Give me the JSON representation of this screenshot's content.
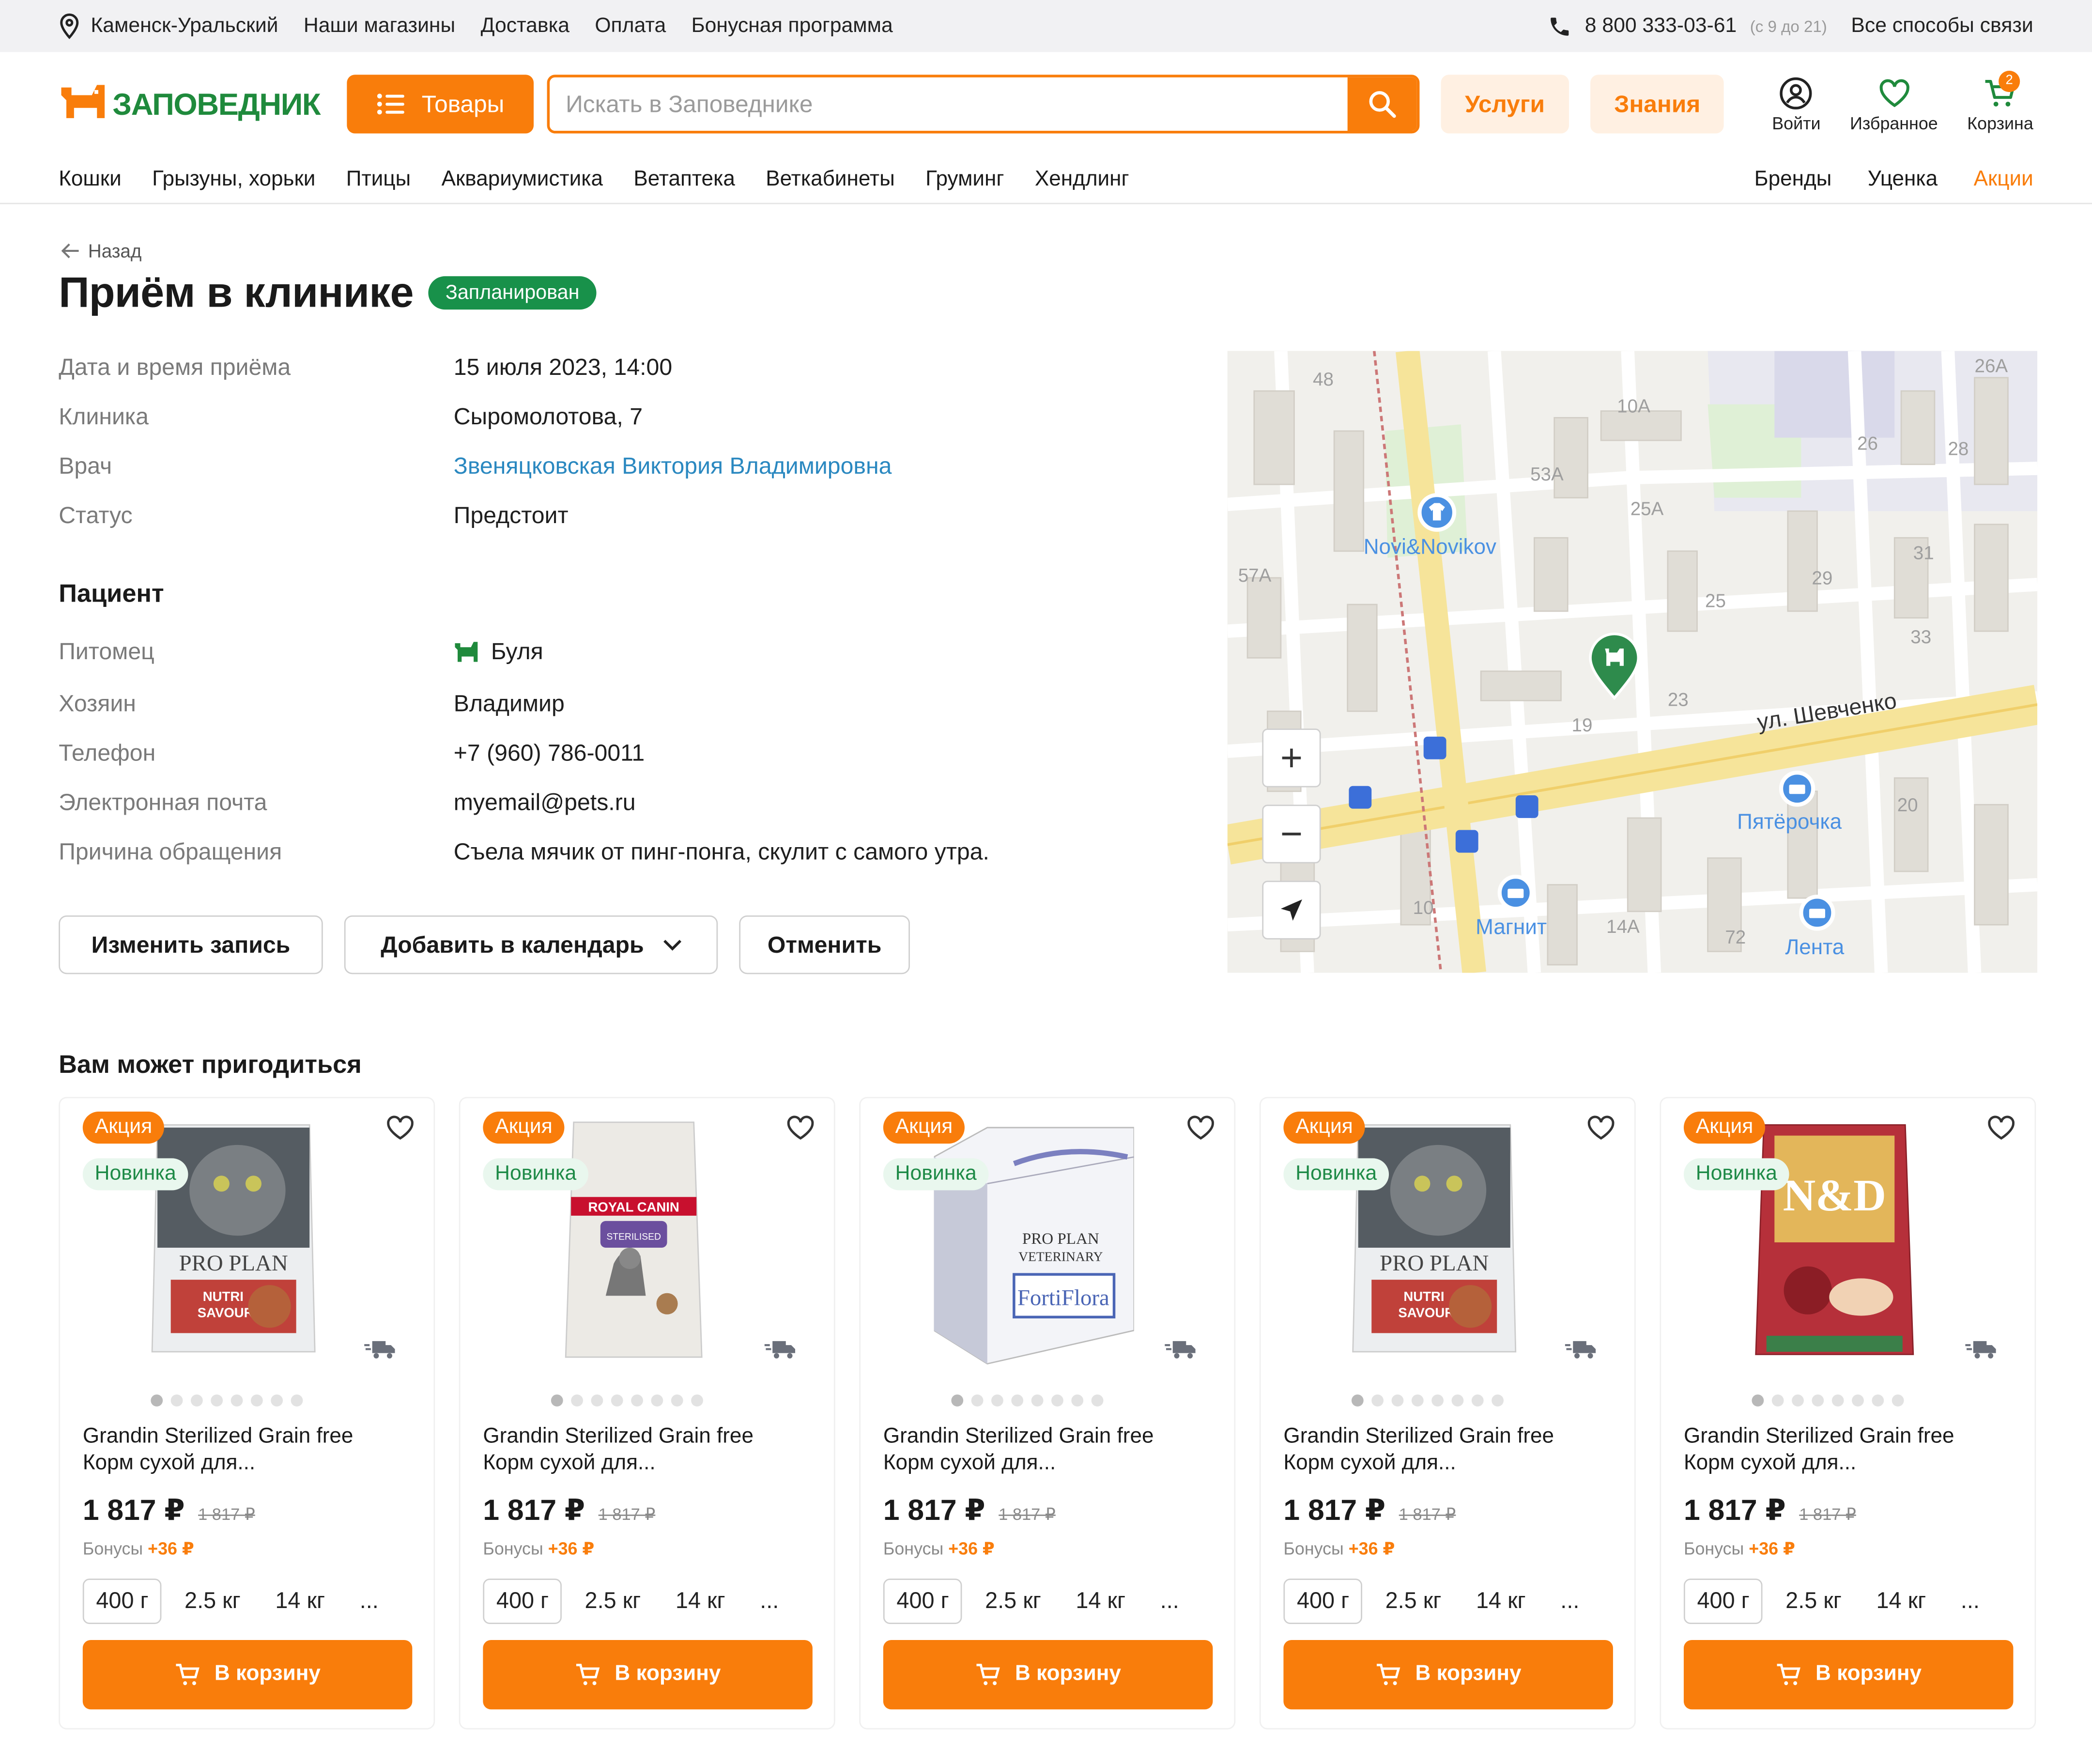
{
  "topbar": {
    "city": "Каменск-Уральский",
    "links": [
      "Наши магазины",
      "Доставка",
      "Оплата",
      "Бонусная программа"
    ],
    "phone": "8 800 333-03-61",
    "hours": "(с 9 до 21)",
    "contacts": "Все способы связи"
  },
  "header": {
    "logo_text": "ЗАПОВЕДНИК",
    "goods_button": "Товары",
    "search_placeholder": "Искать в Заповеднике",
    "services": "Услуги",
    "knowledge": "Знания",
    "login": "Войти",
    "favorites": "Избранное",
    "cart": "Корзина",
    "cart_count": "2"
  },
  "nav": {
    "left": [
      "Кошки",
      "Грызуны, хорьки",
      "Птицы",
      "Аквариумистика",
      "Ветаптека",
      "Веткабинеты",
      "Груминг",
      "Хендлинг"
    ],
    "right": [
      "Бренды",
      "Уценка",
      "Акции"
    ]
  },
  "page": {
    "back": "Назад",
    "title": "Приём в клинике",
    "status_badge": "Запланирован",
    "details": [
      {
        "label": "Дата и время приёма",
        "value": "15 июля 2023,  14:00"
      },
      {
        "label": "Клиника",
        "value": "Сыромолотова, 7"
      },
      {
        "label": "Врач",
        "value": "Звеняцковская Виктория Владимировна"
      },
      {
        "label": "Статус",
        "value": "Предстоит"
      }
    ],
    "patient_heading": "Пациент",
    "patient": [
      {
        "label": "Питомец",
        "value": "Буля"
      },
      {
        "label": "Хозяин",
        "value": "Владимир"
      },
      {
        "label": "Телефон",
        "value": "+7 (960) 786-0011"
      },
      {
        "label": "Электронная почта",
        "value": "myemail@pets.ru"
      },
      {
        "label": "Причина обращения",
        "value": "Съела мячик от пинг-понга, скулит с самого утра."
      }
    ],
    "buttons": {
      "edit": "Изменить запись",
      "calendar": "Добавить в календарь",
      "cancel": "Отменить"
    }
  },
  "map": {
    "street": "ул. Шевченко",
    "pois": [
      "Novi&Novikov",
      "Пятёрочка",
      "Магнит",
      "Лента"
    ],
    "houses": [
      "48",
      "10A",
      "26A",
      "26",
      "28",
      "53A",
      "25A",
      "31",
      "57A",
      "29",
      "25",
      "33",
      "19",
      "23",
      "19",
      "20",
      "10",
      "14A",
      "72"
    ]
  },
  "recommend": {
    "heading": "Вам может пригодиться",
    "products": [
      {
        "sale": "Акция",
        "new": "Новинка",
        "name": "Grandin Sterilized Grain free Корм сухой для...",
        "price": "1 817 ₽",
        "old": "1 817 ₽",
        "bonus_label": "Бонусы",
        "bonus": "+36 ₽",
        "sizes": [
          "400 г",
          "2.5 кг",
          "14 кг",
          "..."
        ],
        "cart": "В корзину",
        "image": "pouch"
      },
      {
        "sale": "Акция",
        "new": "Новинка",
        "name": "Grandin Sterilized Grain free Корм сухой для...",
        "price": "1 817 ₽",
        "old": "1 817 ₽",
        "bonus_label": "Бонусы",
        "bonus": "+36 ₽",
        "sizes": [
          "400 г",
          "2.5 кг",
          "14 кг",
          "..."
        ],
        "cart": "В корзину",
        "image": "bag"
      },
      {
        "sale": "Акция",
        "new": "Новинка",
        "name": "Grandin Sterilized Grain free Корм сухой для...",
        "price": "1 817 ₽",
        "old": "1 817 ₽",
        "bonus_label": "Бонусы",
        "bonus": "+36 ₽",
        "sizes": [
          "400 г",
          "2.5 кг",
          "14 кг",
          "..."
        ],
        "cart": "В корзину",
        "image": "box"
      },
      {
        "sale": "Акция",
        "new": "Новинка",
        "name": "Grandin Sterilized Grain free Корм сухой для...",
        "price": "1 817 ₽",
        "old": "1 817 ₽",
        "bonus_label": "Бонусы",
        "bonus": "+36 ₽",
        "sizes": [
          "400 г",
          "2.5 кг",
          "14 кг",
          "..."
        ],
        "cart": "В корзину",
        "image": "pouch"
      },
      {
        "sale": "Акция",
        "new": "Новинка",
        "name": "Grandin Sterilized Grain free Корм сухой для...",
        "price": "1 817 ₽",
        "old": "1 817 ₽",
        "bonus_label": "Бонусы",
        "bonus": "+36 ₽",
        "sizes": [
          "400 г",
          "2.5 кг",
          "14 кг",
          "..."
        ],
        "cart": "В корзину",
        "image": "nd"
      }
    ]
  },
  "colors": {
    "accent": "#f97d0b",
    "brand_green": "#1f8a3c",
    "status_green": "#18914a",
    "link": "#2a88c0"
  }
}
